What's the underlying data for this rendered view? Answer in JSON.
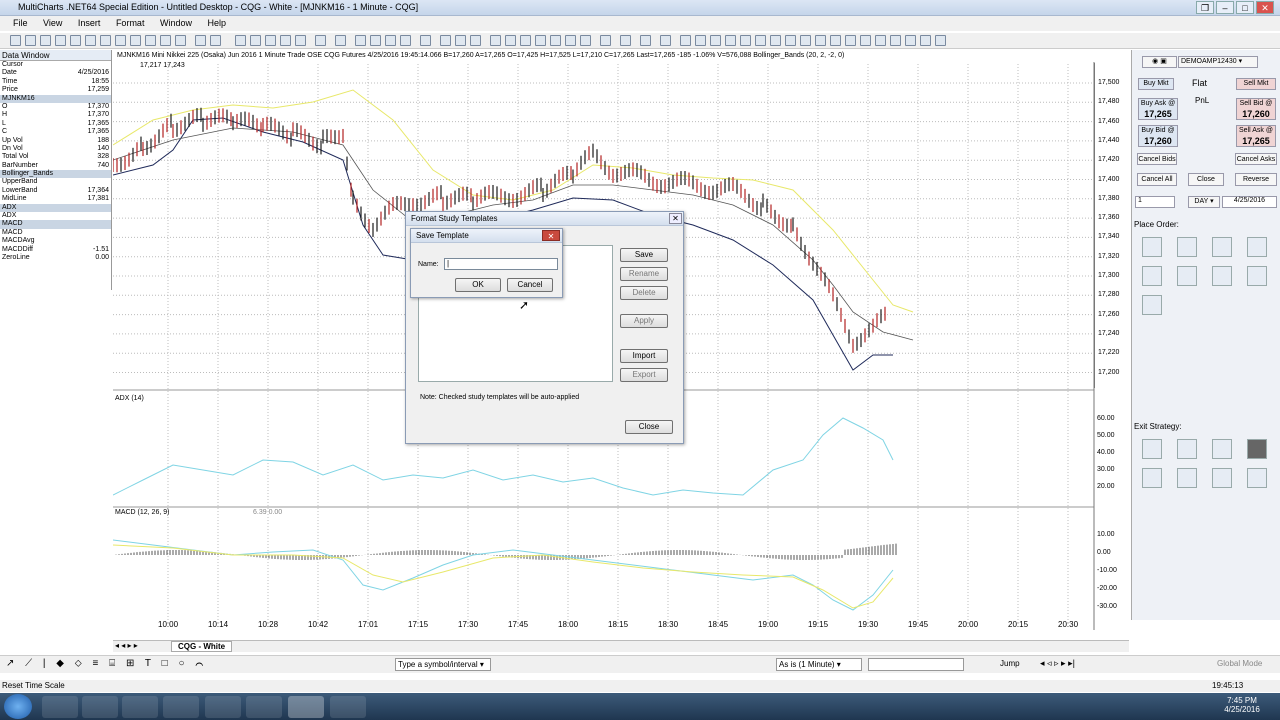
{
  "window": {
    "title": "MultiCharts .NET64 Special Edition - Untitled Desktop - CQG - White - [MJNKM16 - 1 Minute - CQG]"
  },
  "menu": [
    "File",
    "View",
    "Insert",
    "Format",
    "Window",
    "Help"
  ],
  "data_window": {
    "title": "Data Window",
    "rows": [
      {
        "label": "Cursor",
        "value": "",
        "section": false
      },
      {
        "label": "Date",
        "value": "4/25/2016",
        "section": false
      },
      {
        "label": "Time",
        "value": "18:55",
        "section": false
      },
      {
        "label": "Price",
        "value": "17,259",
        "section": false
      },
      {
        "label": "MJNKM16",
        "value": "",
        "section": true
      },
      {
        "label": "O",
        "value": "17,370",
        "section": false
      },
      {
        "label": "H",
        "value": "17,370",
        "section": false
      },
      {
        "label": "L",
        "value": "17,365",
        "section": false
      },
      {
        "label": "C",
        "value": "17,365",
        "section": false
      },
      {
        "label": "Up Vol",
        "value": "188",
        "section": false
      },
      {
        "label": "Dn Vol",
        "value": "140",
        "section": false
      },
      {
        "label": "Total Vol",
        "value": "328",
        "section": false
      },
      {
        "label": "BarNumber",
        "value": "740",
        "section": false
      },
      {
        "label": "Bollinger_Bands",
        "value": "",
        "section": true
      },
      {
        "label": "UpperBand",
        "value": "",
        "section": false
      },
      {
        "label": "LowerBand",
        "value": "17,364",
        "section": false
      },
      {
        "label": "MidLine",
        "value": "17,381",
        "section": false
      },
      {
        "label": "ADX",
        "value": "",
        "section": true
      },
      {
        "label": "ADX",
        "value": "",
        "section": false
      },
      {
        "label": "MACD",
        "value": "",
        "section": true
      },
      {
        "label": "MACD",
        "value": "",
        "section": false
      },
      {
        "label": "MACDAvg",
        "value": "",
        "section": false
      },
      {
        "label": "MACDDiff",
        "value": "-1.51",
        "section": false
      },
      {
        "label": "ZeroLine",
        "value": "0.00",
        "section": false
      }
    ]
  },
  "chart": {
    "header": "MJNKM16    Mini Nikkei 225 (Osaka) Jun 2016  1 Minute    Trade  OSE  CQG Futures  4/25/2016 19:45:14.066  B=17,260  A=17,265  O=17,425  H=17,525  L=17,210  C=17,265  Last=17,265  -185  -1.06%  V=576,088    Bollinger_Bands   (20, 2, -2, 0)",
    "subheader": "17,217  17,243",
    "price_ticks": [
      "17,500",
      "17,480",
      "17,460",
      "17,440",
      "17,420",
      "17,400",
      "17,380",
      "17,360",
      "17,340",
      "17,320",
      "17,300",
      "17,280",
      "17,260",
      "17,240",
      "17,220",
      "17,200"
    ],
    "time_ticks": [
      "10:00",
      "10:14",
      "10:28",
      "10:42",
      "17:01",
      "17:15",
      "17:30",
      "17:45",
      "18:00",
      "18:15",
      "18:30",
      "18:45",
      "19:00",
      "19:15",
      "19:30",
      "19:45",
      "20:00",
      "20:15",
      "20:30"
    ],
    "adx_label": "ADX  (14)",
    "adx_ticks": [
      "60.00",
      "50.00",
      "40.00",
      "30.00",
      "20.00"
    ],
    "macd_label": "MACD  (12, 26, 9)",
    "macd_values": "6.39  0.00",
    "macd_ticks": [
      "10.00",
      "0.00",
      "-10.00",
      "-20.00",
      "-30.00"
    ],
    "tab": "CQG - White"
  },
  "trade_panel": {
    "account": "DEMOAMP12430",
    "buy_mkt": "Buy Mkt",
    "flat": "Flat",
    "pnl": "PnL",
    "sell_mkt": "Sell Mkt",
    "buy_ask_label": "Buy Ask @",
    "buy_ask_price": "17,265",
    "sell_bid_label": "Sell Bid @",
    "sell_bid_price": "17,260",
    "buy_bid_label": "Buy Bid @",
    "buy_bid_price": "17,260",
    "sell_ask_label": "Sell Ask @",
    "sell_ask_price": "17,265",
    "cancel_bids": "Cancel Bids",
    "cancel_asks": "Cancel Asks",
    "cancel_all": "Cancel All",
    "close": "Close",
    "reverse": "Reverse",
    "qty": "1",
    "tif": "DAY",
    "date": "4/25/2016",
    "place_order": "Place Order:",
    "exit_strategy": "Exit Strategy:"
  },
  "format_dialog": {
    "title": "Format Study Templates",
    "save": "Save",
    "rename": "Rename",
    "delete": "Delete",
    "apply": "Apply",
    "import": "Import",
    "export": "Export",
    "note": "Note: Checked study templates will be auto-applied",
    "close": "Close"
  },
  "save_dialog": {
    "title": "Save Template",
    "name_label": "Name:",
    "name_value": "",
    "ok": "OK",
    "cancel": "Cancel"
  },
  "bottom_toolbar": {
    "symbol_placeholder": "Type a symbol/interval",
    "resolution": "As is (1 Minute)",
    "jump": "Jump",
    "global_mode": "Global Mode"
  },
  "status": {
    "left": "Reset Time Scale",
    "time": "19:45:13"
  },
  "taskbar": {
    "clock_time": "7:45 PM",
    "clock_date": "4/25/2016"
  }
}
